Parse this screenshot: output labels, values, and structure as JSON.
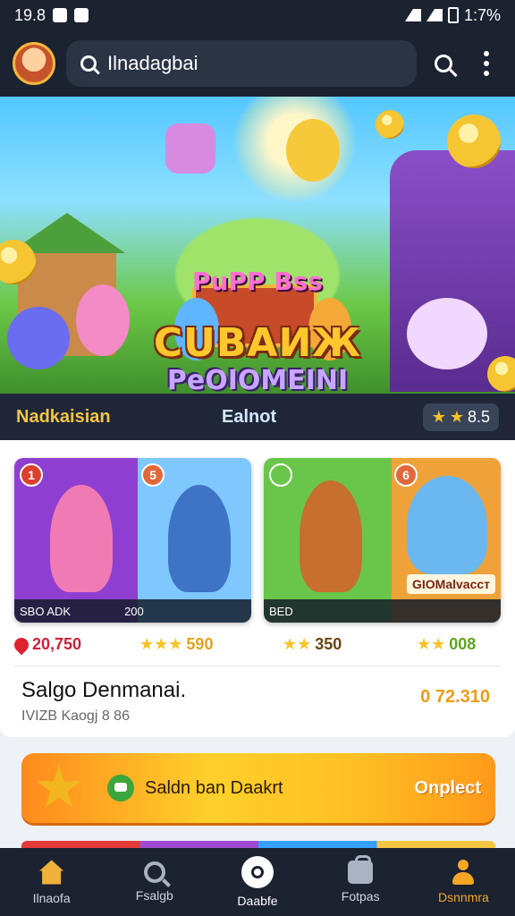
{
  "status_bar": {
    "time_left": "19.8",
    "time_right": "1:7%"
  },
  "header": {
    "search_text": "Ilnadagbai"
  },
  "hero": {
    "small_title": "PuPP Bss",
    "main_title": "CUBAИЖ",
    "subtitle": "PeOIOMEINI",
    "bar_left": "Nadkaisian",
    "bar_mid": "Ealnot",
    "rating": "8.5"
  },
  "game_cards": [
    {
      "badge_left": "1",
      "badge_right": "5",
      "strip_left": "SBO ADK",
      "strip_right": "200"
    },
    {
      "badge_left": "",
      "badge_right": "6",
      "strip_left": "BED",
      "name_tag": "GIOMalvaccт"
    }
  ],
  "prices": {
    "p1": "20,750",
    "p2": "590",
    "p3": "350",
    "p4": "008"
  },
  "info": {
    "title": "Salgo Denmanai.",
    "subtitle": "IVIZB Kaogj 8 86",
    "price": "0 72.310"
  },
  "banner": {
    "text": "Saldn ban Daakrt",
    "cta": "Onplect"
  },
  "nav": {
    "items": [
      "Ilnaofa",
      "Fsalgb",
      "Daabfe",
      "Fotpas",
      "Dsnnmra"
    ]
  },
  "colors": {
    "dark_bg": "#1b2230",
    "accent_gold": "#f5c542",
    "accent_orange": "#f09a1a"
  }
}
